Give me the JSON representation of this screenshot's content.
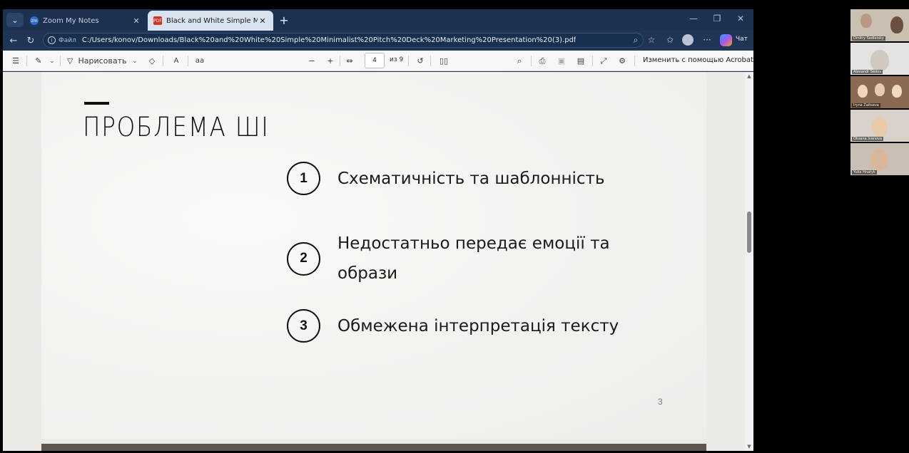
{
  "browser": {
    "tabs": [
      {
        "title": "Zoom My Notes",
        "active": false
      },
      {
        "title": "Black and White Simple Minimalist",
        "active": true
      }
    ],
    "address": {
      "scheme_label": "Файл",
      "url": "C:/Users/konov/Downloads/Black%20and%20White%20Simple%20Minimalist%20Pitch%20Deck%20Marketing%20Presentation%20(3).pdf"
    },
    "chat_label": "Чат"
  },
  "pdf_toolbar": {
    "draw_label": "Нарисовать",
    "current_page": "4",
    "page_of": "из 9",
    "edit_acrobat": "Изменить с помощью Acrobat"
  },
  "slide": {
    "title": "ПРОБЛЕМА ШІ",
    "items": [
      {
        "number": "1",
        "text": "Схематичність та шаблонність"
      },
      {
        "number": "2",
        "text": "Недостатньо передає емоції та образи"
      },
      {
        "number": "3",
        "text": "Обмежена інтерпретація тексту"
      }
    ],
    "page_number": "3"
  },
  "zoom_participants": [
    {
      "name": "Dmitry Sedletsky"
    },
    {
      "name": "Alexandr Sedov"
    },
    {
      "name": "Iryna Zaitseva"
    },
    {
      "name": "Oksana Ivanova"
    },
    {
      "name": "Yulia Hnatyk"
    }
  ]
}
